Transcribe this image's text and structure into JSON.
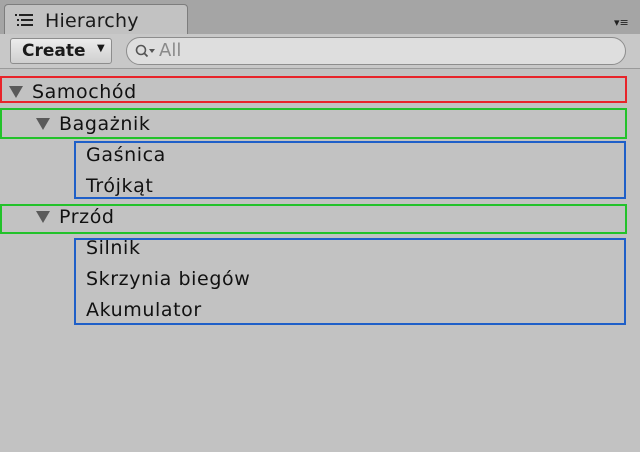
{
  "panel": {
    "tab_label": "Hierarchy",
    "menu_glyph": "▾≡"
  },
  "toolbar": {
    "create_label": "Create",
    "create_caret": "▼",
    "search_placeholder": "All"
  },
  "tree": {
    "root": {
      "label": "Samochód",
      "expanded": true
    },
    "groups": [
      {
        "label": "Bagażnik",
        "expanded": true,
        "children": [
          "Gaśnica",
          "Trójkąt"
        ]
      },
      {
        "label": "Przód",
        "expanded": true,
        "children": [
          "Silnik",
          "Skrzynia biegów",
          "Akumulator"
        ]
      }
    ]
  },
  "highlight_colors": {
    "root": "#e8242a",
    "group": "#22c22a",
    "children": "#1e5fc8"
  }
}
